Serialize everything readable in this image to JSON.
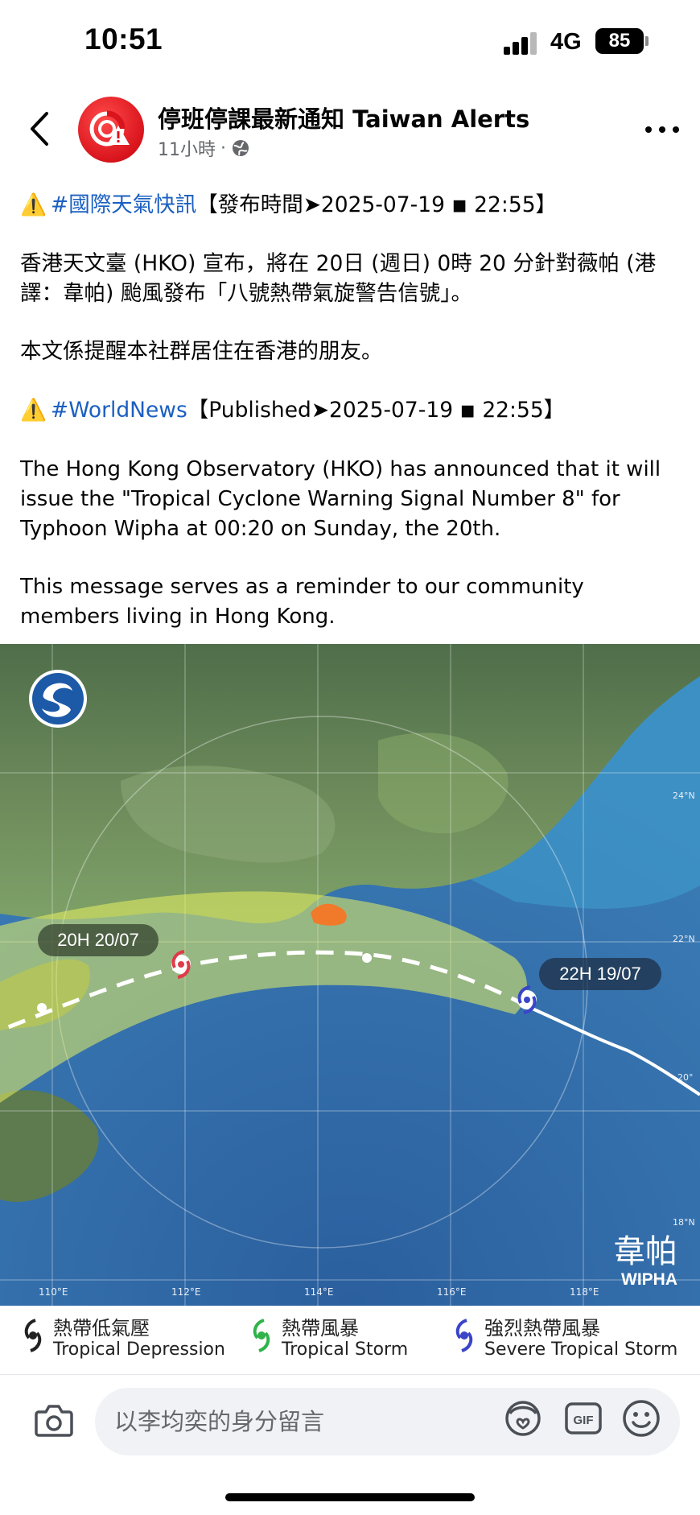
{
  "status_bar": {
    "time": "10:51",
    "network": "4G",
    "battery": "85"
  },
  "header": {
    "page_name": "停班停課最新通知 Taiwan Alerts",
    "time_ago": "11小時",
    "dot": "·"
  },
  "post": {
    "zh_hashtag": "#國際天氣快訊",
    "zh_meta": "【發布時間➤2025-07-19 ◾ 22:55】",
    "zh_para1": "香港天文臺 (HKO) 宣布，將在 20日 (週日) 0時 20 分針對薇帕 (港譯：韋帕) 颱風發布「八號熱帶氣旋警告信號」。",
    "zh_para2": "本文係提醒本社群居住在香港的朋友。",
    "en_hashtag": "#WorldNews",
    "en_meta": "【Published➤2025-07-19 ◾ 22:55】",
    "en_para1": "The Hong Kong Observatory (HKO) has announced that it will issue the \"Tropical Cyclone Warning Signal Number 8\" for Typhoon Wipha at 00:20 on Sunday, the 20th.",
    "en_para2": "This message serves as a reminder to our community members living in Hong Kong."
  },
  "map": {
    "label_forecast": "20H 20/07",
    "label_current": "22H 19/07",
    "storm_name_zh": "韋帕",
    "storm_name_en": "WIPHA",
    "lon_labels": [
      "110°E",
      "112°E",
      "114°E",
      "116°E",
      "118°E"
    ],
    "lat_labels": [
      "24°N",
      "22°N",
      "18°N",
      "20°"
    ],
    "colors": {
      "sea": "#2f6aa6",
      "cone": "#e8f060",
      "track": "#ffffff",
      "hk": "#f07a2a"
    }
  },
  "legend": [
    {
      "zh": "熱帶低氣壓",
      "en": "Tropical Depression",
      "color": "#222222"
    },
    {
      "zh": "熱帶風暴",
      "en": "Tropical Storm",
      "color": "#2fb34a"
    },
    {
      "zh": "強烈熱帶風暴",
      "en": "Severe Tropical Storm",
      "color": "#3a45c8"
    }
  ],
  "composer": {
    "placeholder": "以李均奕的身分留言"
  }
}
